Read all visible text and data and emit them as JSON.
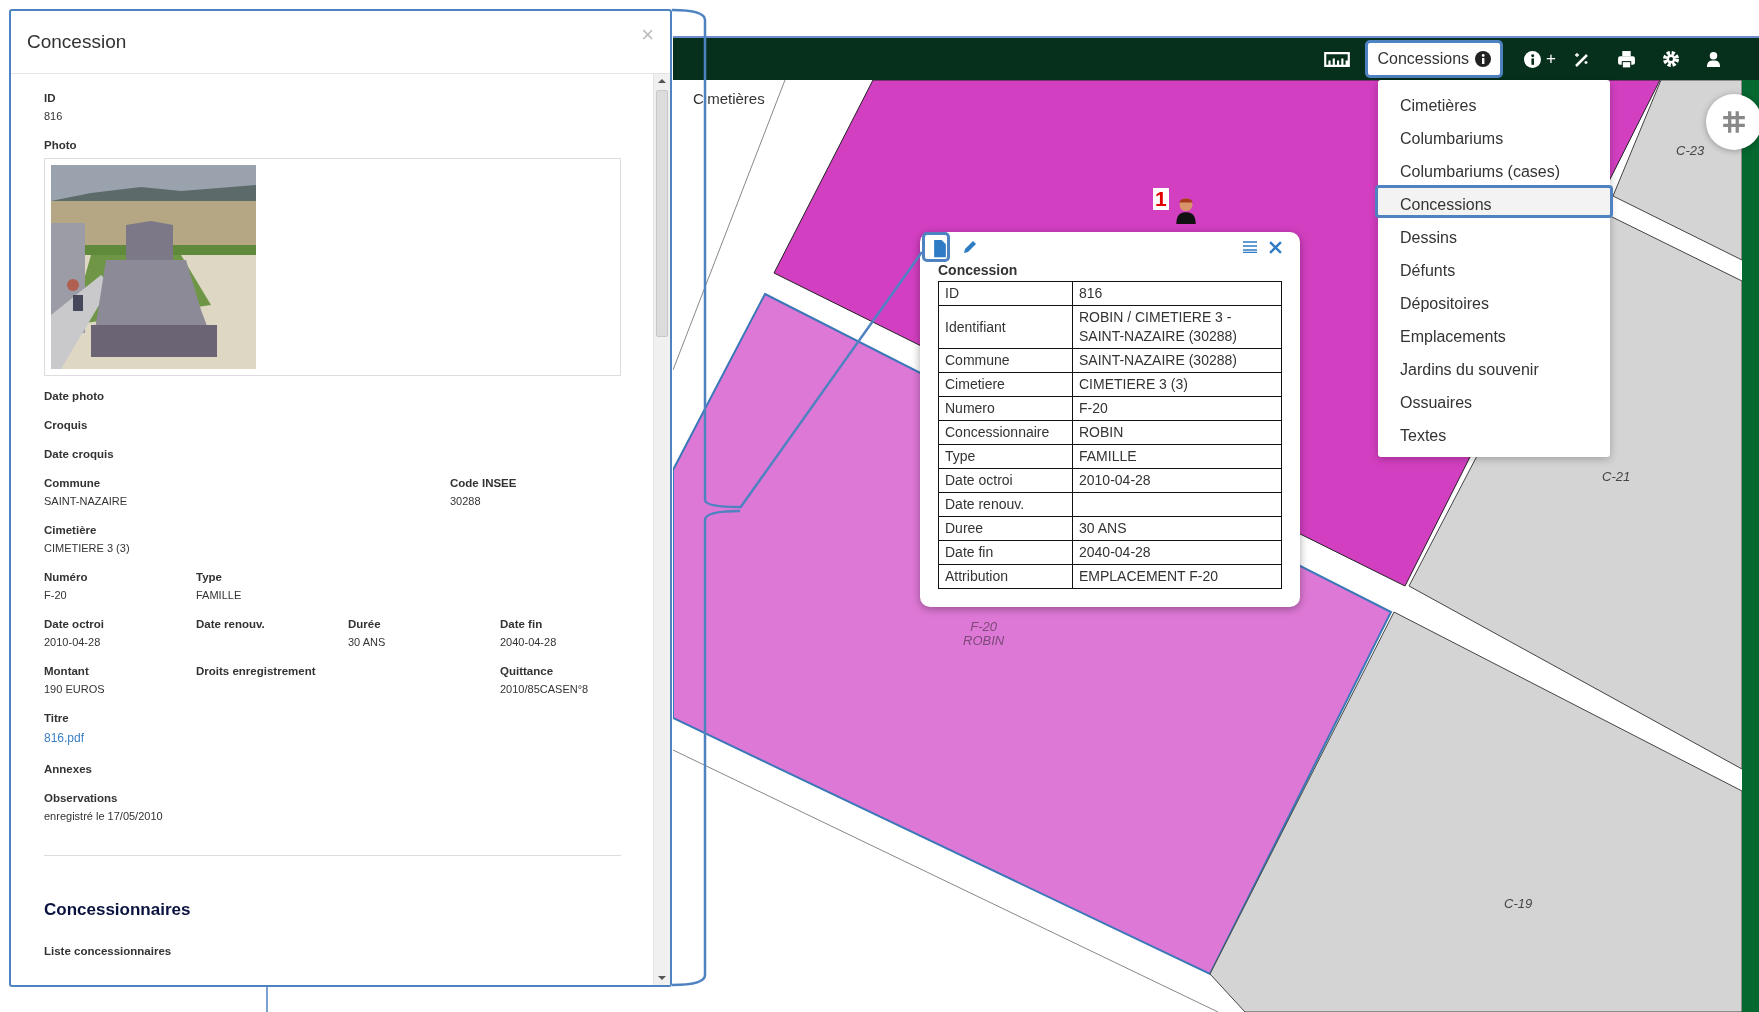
{
  "panel": {
    "title": "Concession",
    "close": "×",
    "rows": [
      {
        "kind": "fields",
        "items": [
          {
            "label": "ID",
            "value": "816"
          }
        ]
      },
      {
        "items": [
          {
            "label": "Photo"
          }
        ]
      },
      {
        "kind": "fields",
        "items": [
          {
            "label": "Date photo"
          }
        ]
      },
      {
        "kind": "fields",
        "items": [
          {
            "label": "Croquis"
          }
        ]
      },
      {
        "kind": "fields",
        "items": [
          {
            "label": "Date croquis"
          }
        ]
      },
      {
        "kind": "fields",
        "items": [
          {
            "label": "Commune",
            "value": "SAINT-NAZAIRE"
          },
          {
            "label": "Code INSEE",
            "value": "30288"
          }
        ]
      },
      {
        "kind": "fields",
        "items": [
          {
            "label": "Cimetière",
            "value": "CIMETIERE 3 (3)"
          }
        ]
      },
      {
        "kind": "fields",
        "items": [
          {
            "label": "Numéro",
            "value": "F-20"
          },
          {
            "label": "Type",
            "value": "FAMILLE"
          }
        ]
      },
      {
        "kind": "fields",
        "items": [
          {
            "label": "Date octroi",
            "value": "2010-04-28"
          },
          {
            "label": "Date renouv."
          },
          {
            "label": "Durée",
            "value": "30 ANS"
          },
          {
            "label": "Date fin",
            "value": "2040-04-28"
          }
        ]
      },
      {
        "kind": "fields",
        "items": [
          {
            "label": "Montant",
            "value": "190 EUROS"
          },
          {
            "label": "Droits enregistrement"
          },
          {
            "label": "Quittance",
            "value": "2010/85CASEN°8"
          }
        ]
      },
      {
        "kind": "fields",
        "items": [
          {
            "label": "Titre",
            "link": "816.pdf"
          }
        ]
      },
      {
        "kind": "fields",
        "items": [
          {
            "label": "Annexes"
          }
        ]
      },
      {
        "kind": "fields",
        "items": [
          {
            "label": "Observations",
            "value": "enregistré le 17/05/2010"
          }
        ]
      }
    ],
    "section_title": "Concessionnaires",
    "subsection": "Liste concessionnaires"
  },
  "toolbar": {
    "layer_button": {
      "label": "Concessions",
      "highlighted": true
    },
    "add_label": "+"
  },
  "menu": [
    {
      "label": "Cimetières",
      "selected": false
    },
    {
      "label": "Columbariums",
      "selected": false
    },
    {
      "label": "Columbariums (cases)",
      "selected": false
    },
    {
      "label": "Concessions",
      "selected": true
    },
    {
      "label": "Dessins",
      "selected": false
    },
    {
      "label": "Défunts",
      "selected": false
    },
    {
      "label": "Dépositoires",
      "selected": false
    },
    {
      "label": "Emplacements",
      "selected": false
    },
    {
      "label": "Jardins du souvenir",
      "selected": false
    },
    {
      "label": "Ossuaires",
      "selected": false
    },
    {
      "label": "Textes",
      "selected": false
    }
  ],
  "map": {
    "layer_label": "Cimetières",
    "marker_count": "1",
    "parcel_labels": [
      "C-23",
      "C-21",
      "C-19"
    ],
    "marker_label": [
      "F-20",
      "ROBIN"
    ]
  },
  "popup": {
    "file_highlighted": true,
    "title": "Concession",
    "rows": [
      {
        "label": "ID",
        "value": "816"
      },
      {
        "label": "Identifiant",
        "value": "ROBIN / CIMETIERE 3 - SAINT-NAZAIRE (30288)"
      },
      {
        "label": "Commune",
        "value": "SAINT-NAZAIRE (30288)"
      },
      {
        "label": "Cimetiere",
        "value": "CIMETIERE 3 (3)"
      },
      {
        "label": "Numero",
        "value": "F-20"
      },
      {
        "label": "Concessionnaire",
        "value": "ROBIN"
      },
      {
        "label": "Type",
        "value": "FAMILLE"
      },
      {
        "label": "Date octroi",
        "value": "2010-04-28"
      },
      {
        "label": "Date renouv."
      },
      {
        "label": "Duree",
        "value": "30 ANS"
      },
      {
        "label": "Date fin",
        "value": "2040-04-28"
      },
      {
        "label": "Attribution",
        "value": "EMPLACEMENT F-20"
      }
    ]
  }
}
